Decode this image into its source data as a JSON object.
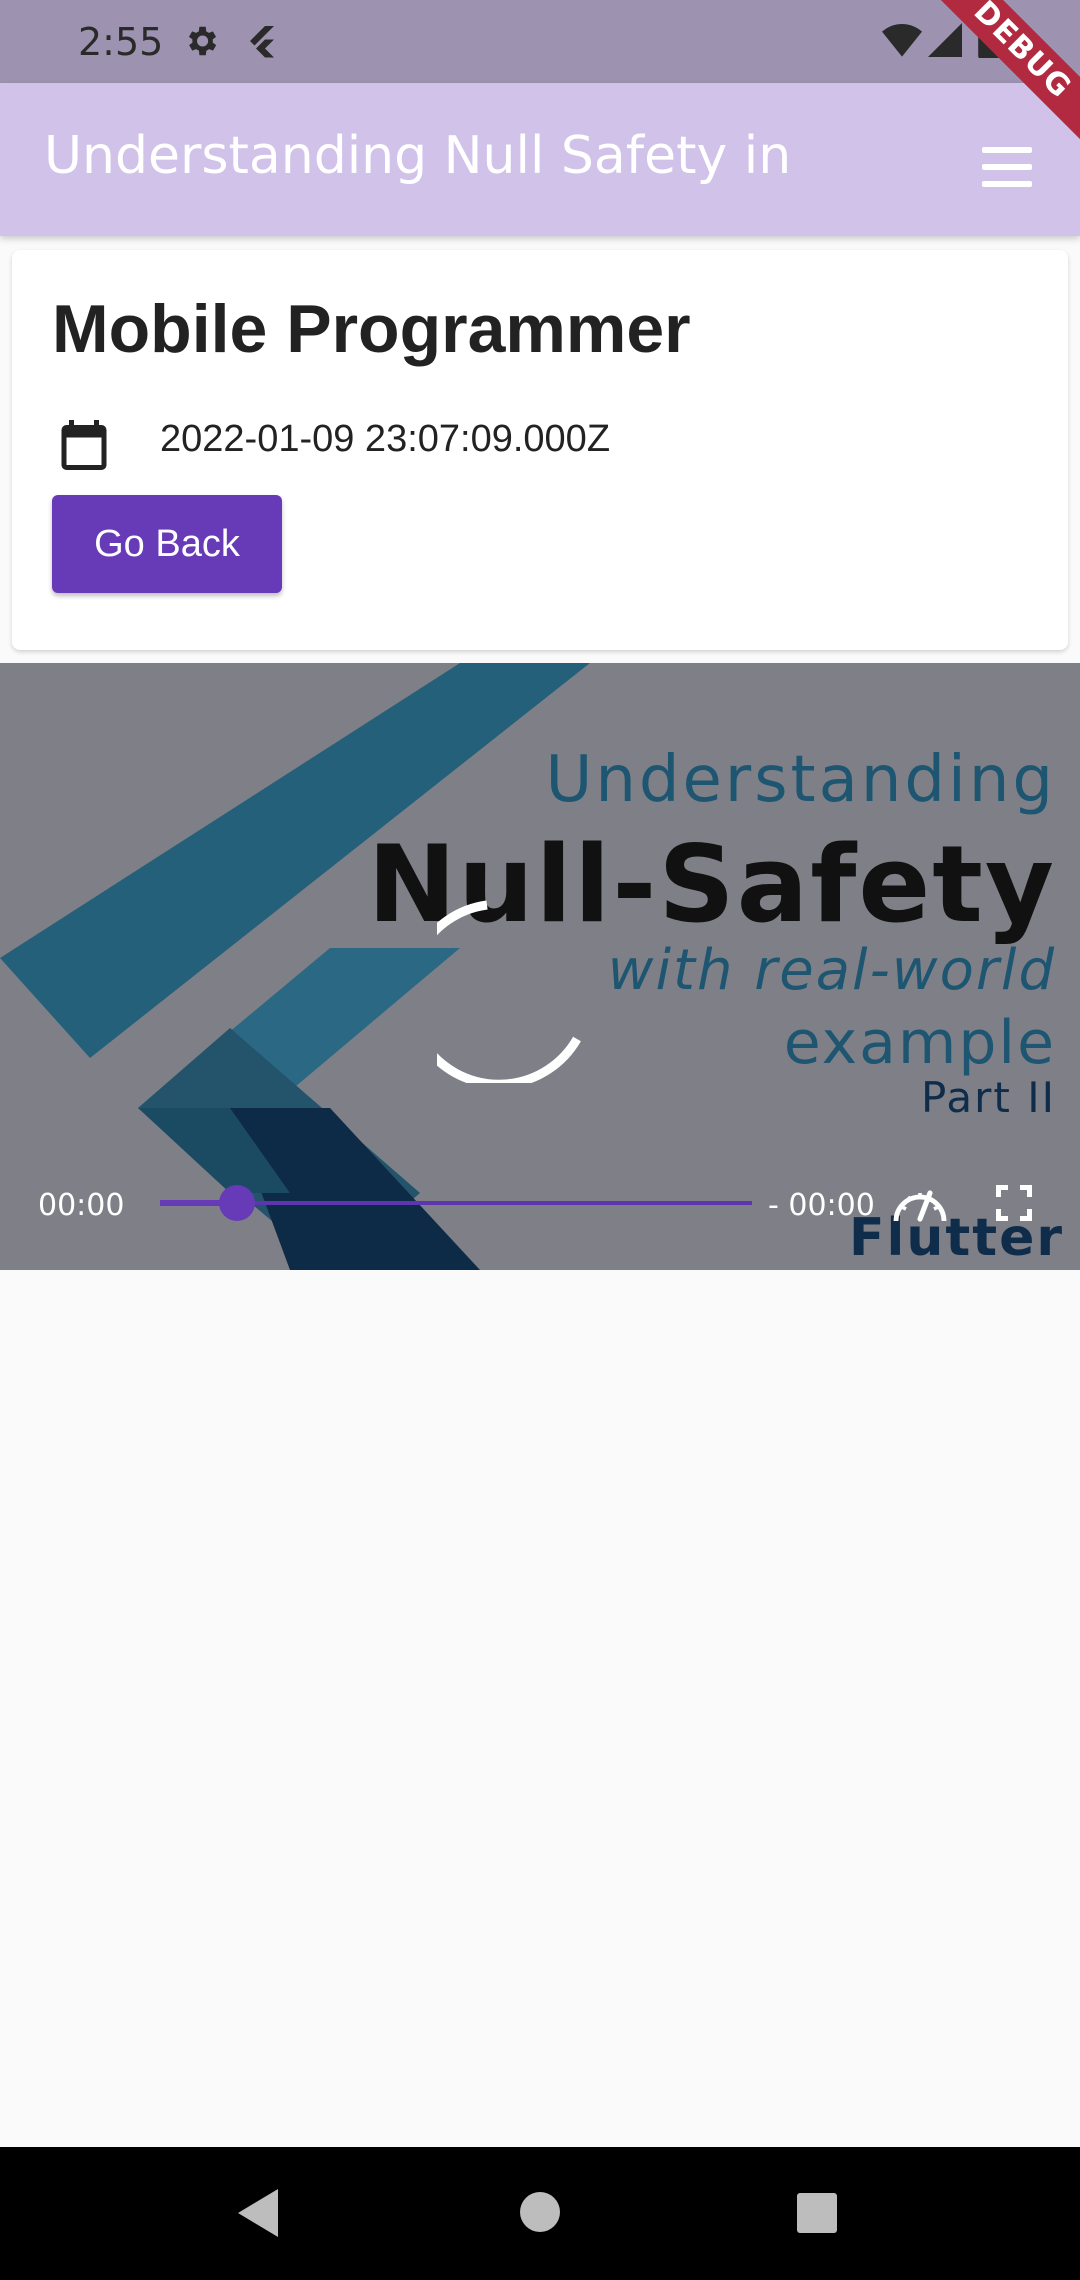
{
  "status_bar": {
    "time": "2:55",
    "icons": [
      "settings-icon",
      "flutter-icon",
      "wifi-icon",
      "signal-icon",
      "battery-icon"
    ],
    "debug_label": "DEBUG"
  },
  "app_bar": {
    "title": "Understanding Null Safety in …",
    "menu_icon": "menu-icon"
  },
  "card": {
    "title": "Mobile Programmer",
    "date_icon": "calendar-icon",
    "date": "2022-01-09 23:07:09.000Z",
    "go_back_label": "Go Back"
  },
  "video": {
    "thumbnail": {
      "line1": "Understanding",
      "line2": "Null-Safety",
      "line3": "with real-world",
      "line4": "example",
      "line5": "Part II",
      "line6": "Flutter"
    },
    "time_elapsed": "00:00",
    "time_remaining": "- 00:00",
    "progress": 0.13,
    "loading": true,
    "accent_color": "#673ab7"
  },
  "nav_bar": {
    "icons": [
      "back-icon",
      "home-icon",
      "recents-icon"
    ]
  },
  "colors": {
    "primary": "#673ab7",
    "app_bar": "#d0c2e8",
    "status_bar": "#9d93b1",
    "background": "#fafafa"
  }
}
